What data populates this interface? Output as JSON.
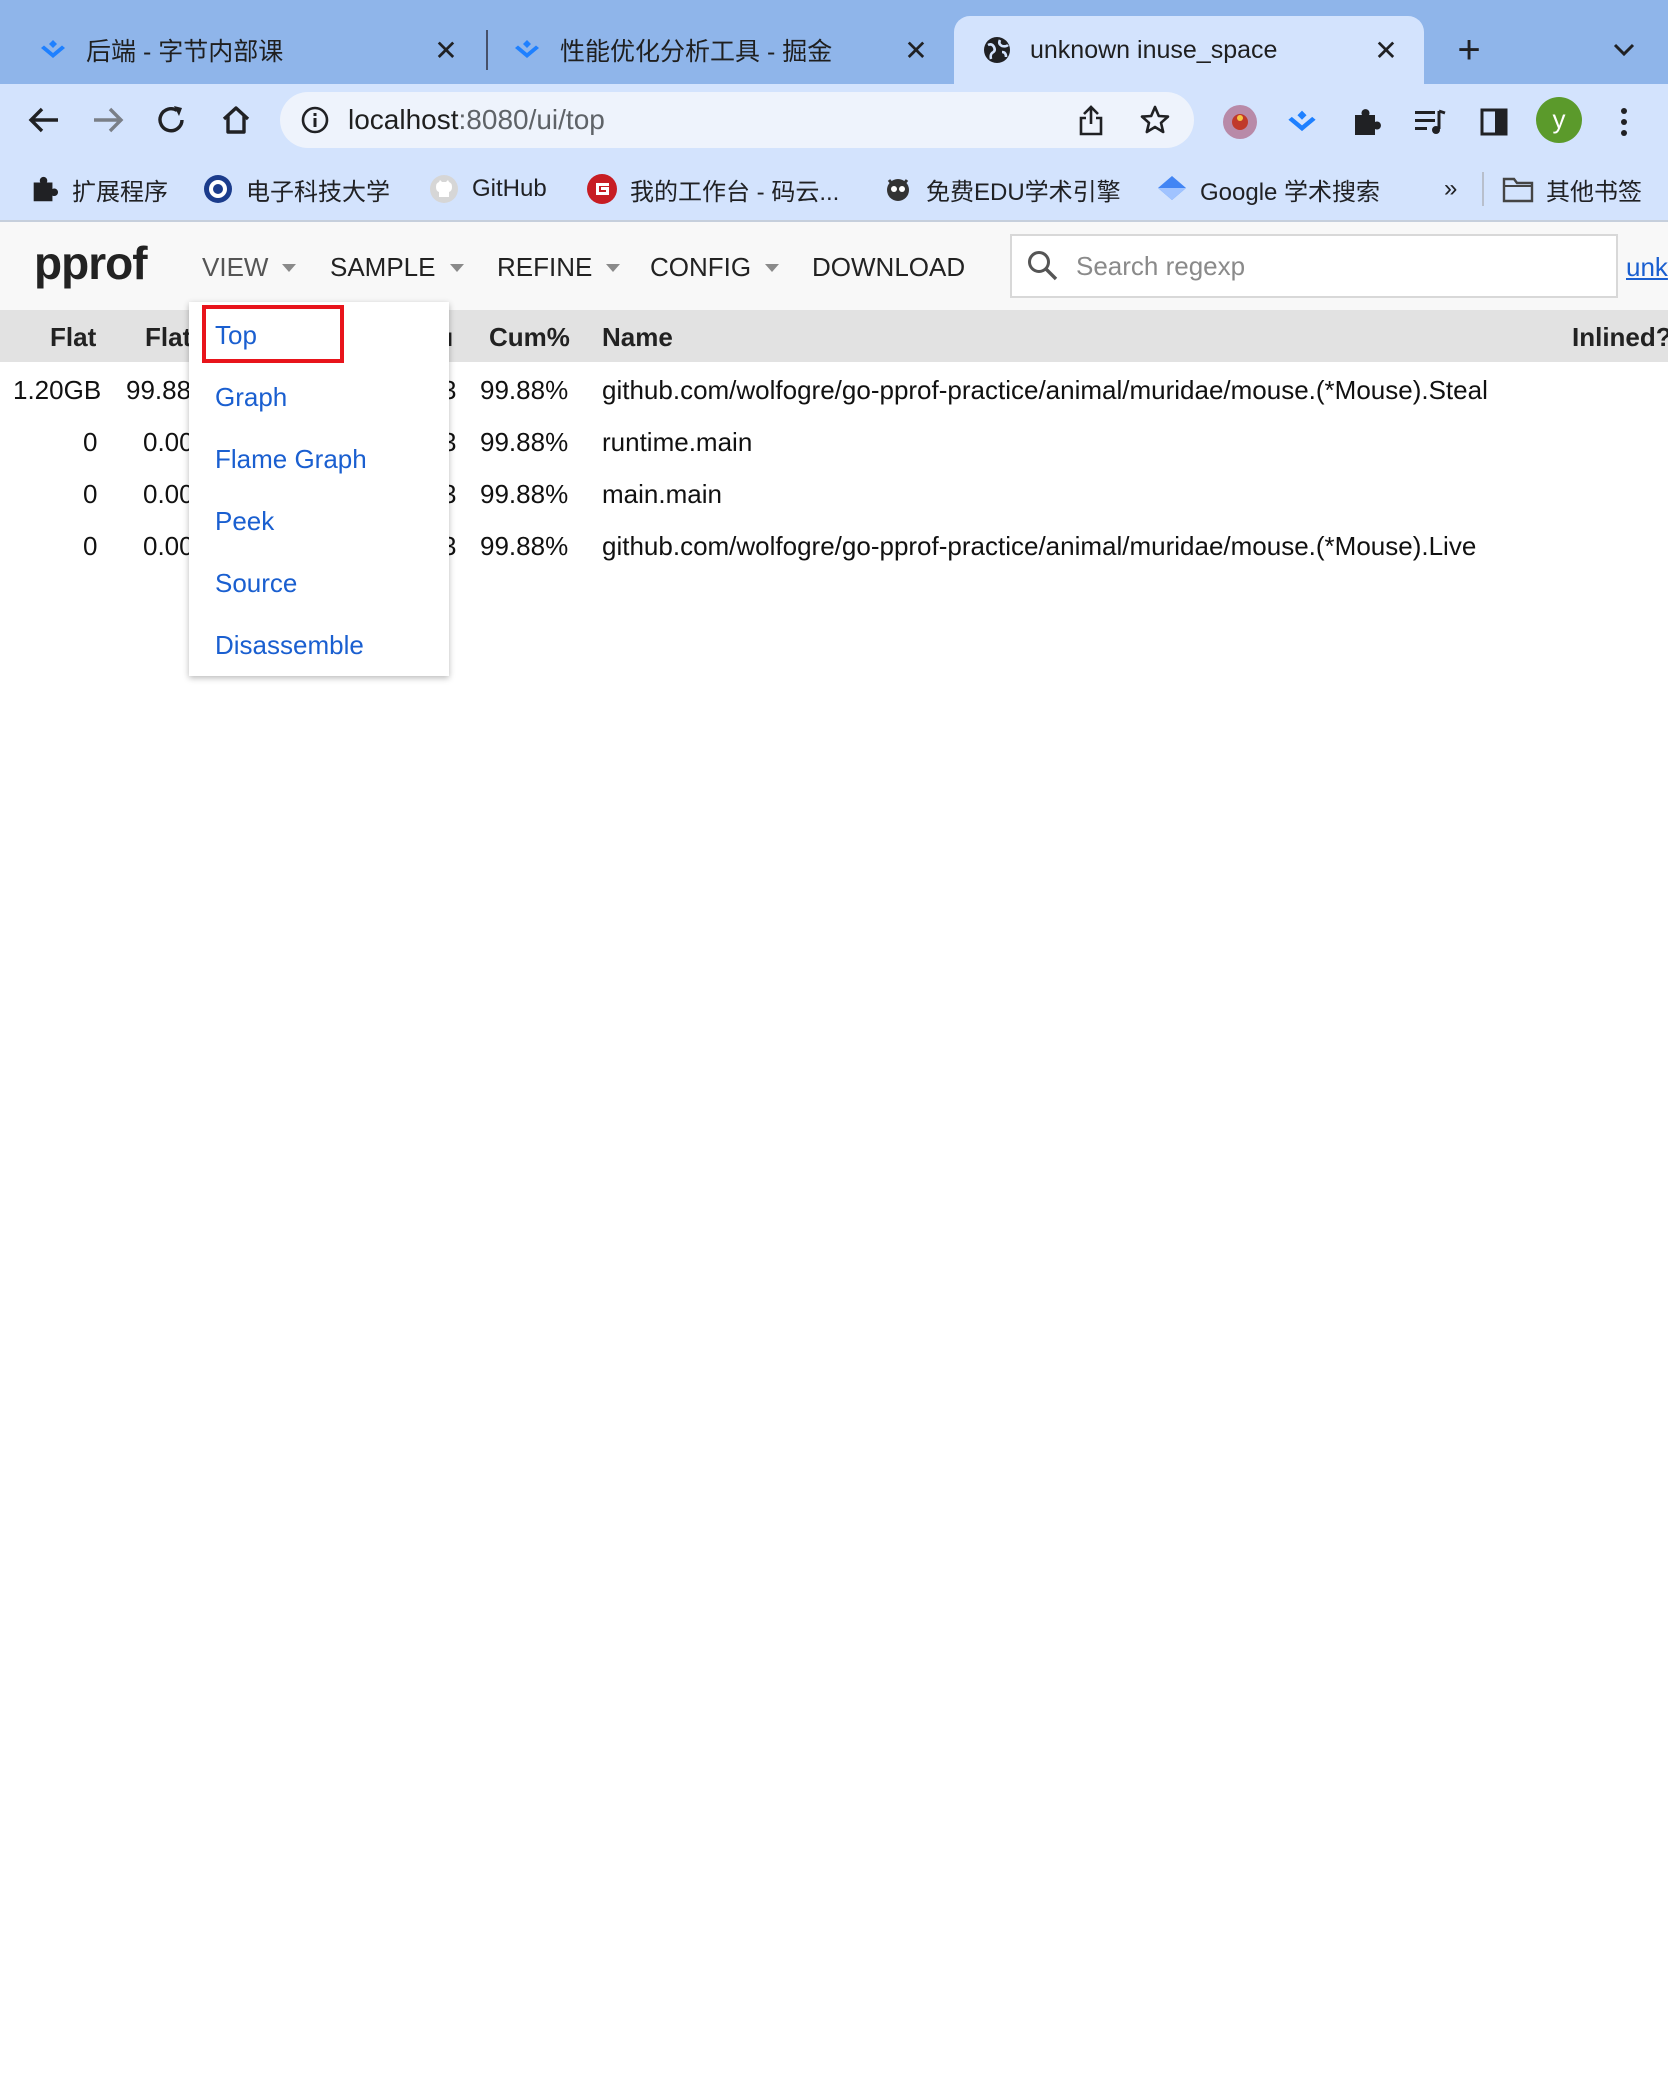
{
  "browser": {
    "tabs": [
      {
        "title": "后端 - 字节内部课",
        "icon": "juejin-icon"
      },
      {
        "title": "性能优化分析工具 - 掘金",
        "icon": "juejin-icon"
      },
      {
        "title": "unknown inuse_space",
        "icon": "globe-icon"
      }
    ],
    "url": {
      "host": "localhost",
      "path": ":8080/ui/top"
    },
    "profile_initial": "y",
    "bookmarks": [
      {
        "label": "扩展程序",
        "icon": "puzzle-icon"
      },
      {
        "label": "电子科技大学",
        "icon": "uestc-logo-icon"
      },
      {
        "label": "GitHub",
        "icon": "github-icon"
      },
      {
        "label": "我的工作台 - 码云...",
        "icon": "gitee-icon"
      },
      {
        "label": "免费EDU学术引擎",
        "icon": "edu-icon"
      },
      {
        "label": "Google 学术搜索",
        "icon": "scholar-icon"
      },
      {
        "label": "其他书签",
        "icon": "folder-icon"
      }
    ],
    "overflow": "»"
  },
  "app": {
    "logo": "pprof",
    "menus": [
      "VIEW",
      "SAMPLE",
      "REFINE",
      "CONFIG",
      "DOWNLOAD"
    ],
    "search_placeholder": "Search regexp",
    "profile_link": "unk"
  },
  "table": {
    "headers": {
      "flat": "Flat",
      "flat_pct": "Flat",
      "cum_pct": "Cum%",
      "name": "Name",
      "inlined": "Inlined?",
      "cum_partial": "ı"
    },
    "rows": [
      {
        "flat": "1.20GB",
        "flat_pct": "99.88",
        "cum_tail": "3",
        "cum_pct": "99.88%",
        "name": "github.com/wolfogre/go-pprof-practice/animal/muridae/mouse.(*Mouse).Steal"
      },
      {
        "flat": "0",
        "flat_pct": "0.00",
        "cum_tail": "3",
        "cum_pct": "99.88%",
        "name": "runtime.main"
      },
      {
        "flat": "0",
        "flat_pct": "0.00",
        "cum_tail": "3",
        "cum_pct": "99.88%",
        "name": "main.main"
      },
      {
        "flat": "0",
        "flat_pct": "0.00",
        "cum_tail": "3",
        "cum_pct": "99.88%",
        "name": "github.com/wolfogre/go-pprof-practice/animal/muridae/mouse.(*Mouse).Live"
      }
    ]
  },
  "view_menu": {
    "items": [
      "Top",
      "Graph",
      "Flame Graph",
      "Peek",
      "Source",
      "Disassemble"
    ],
    "highlighted": "Top",
    "highlight_color": "#e8141b",
    "link_color": "#1a5fd0"
  }
}
